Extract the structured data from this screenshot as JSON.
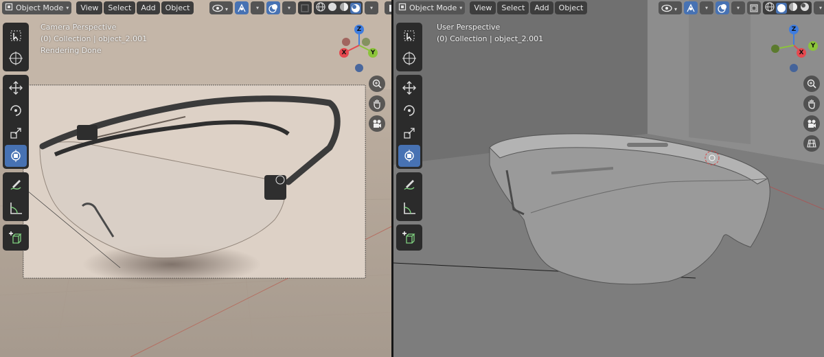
{
  "left_viewport": {
    "mode_label": "Object Mode",
    "menus": [
      "View",
      "Select",
      "Add",
      "Object"
    ],
    "overlay": {
      "line1": "Camera Perspective",
      "line2": "(0) Collection | object_2.001",
      "line3": "Rendering Done"
    },
    "shading": "rendered"
  },
  "right_viewport": {
    "mode_label": "Object Mode",
    "menus": [
      "View",
      "Select",
      "Add",
      "Object"
    ],
    "overlay": {
      "line1": "User Perspective",
      "line2": "(0) Collection | object_2.001"
    },
    "shading": "solid"
  },
  "gizmo_axes": {
    "z": "Z",
    "y": "Y",
    "x": "X"
  },
  "toolbar_tools": [
    "select-box-icon",
    "cursor-icon",
    "move-icon",
    "rotate-icon",
    "scale-icon",
    "transform-icon",
    "annotate-icon",
    "measure-icon",
    "add-cube-icon"
  ],
  "nav_buttons": [
    "zoom-icon",
    "pan-hand-icon",
    "camera-view-icon",
    "ortho-grid-icon"
  ],
  "colors": {
    "accent": "#4772b3",
    "header_button": "#545454",
    "toolbar_bg": "#2b2b2b",
    "axis_x": "#e5494f",
    "axis_y": "#8bc43a",
    "axis_z": "#3f7de0"
  }
}
